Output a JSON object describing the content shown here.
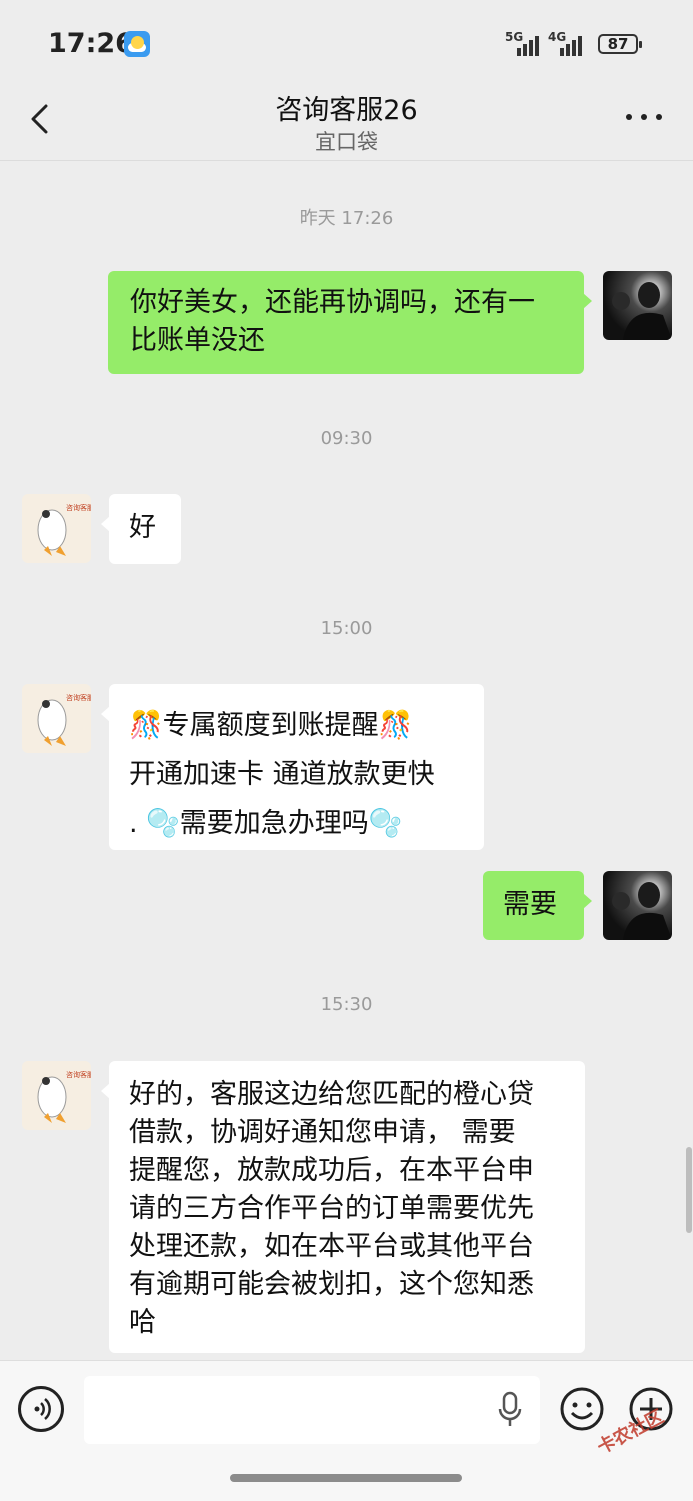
{
  "status_bar": {
    "time": "17:26",
    "signal_1": "5G",
    "signal_2": "4G",
    "battery": "87"
  },
  "header": {
    "title": "咨询客服26",
    "subtitle": "宜口袋"
  },
  "messages": [
    {
      "timestamp": "昨天 17:26",
      "from": "me",
      "text": "你好美女，还能再协调吗，还有一\n比账单没还"
    },
    {
      "timestamp": "09:30",
      "from": "agent",
      "text": "好"
    },
    {
      "timestamp": "15:00",
      "from": "agent",
      "text": "🎊专属额度到账提醒🎊\n开通加速卡 通道放款更快\n. 🫧需要加急办理吗🫧"
    },
    {
      "from": "me",
      "text": "需要"
    },
    {
      "timestamp": "15:30",
      "from": "agent",
      "text": "好的，客服这边给您匹配的橙心贷\n借款，协调好通知您申请， 需要\n提醒您，放款成功后，在本平台申\n请的三方合作平台的订单需要优先\n处理还款，如在本平台或其他平台\n有逾期可能会被划扣，这个您知悉\n哈"
    }
  ],
  "input": {
    "placeholder": ""
  },
  "watermark": "卡农社区"
}
